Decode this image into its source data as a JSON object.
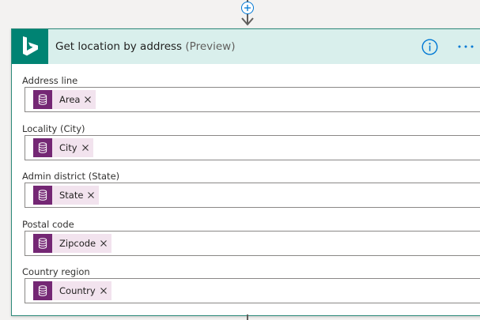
{
  "card": {
    "title": "Get location by address",
    "title_suffix": "(Preview)",
    "logo_icon": "bing-logo-icon",
    "header_color": "#d9efec",
    "logo_bg_color": "#008373"
  },
  "fields": [
    {
      "label": "Address line",
      "token": "Area"
    },
    {
      "label": "Locality (City)",
      "token": "City"
    },
    {
      "label": "Admin district (State)",
      "token": "State"
    },
    {
      "label": "Postal code",
      "token": "Zipcode"
    },
    {
      "label": "Country region",
      "token": "Country"
    }
  ],
  "token_style": {
    "icon": "database-icon",
    "icon_bg_color": "#742774",
    "bg_color": "#f2e3ee"
  }
}
